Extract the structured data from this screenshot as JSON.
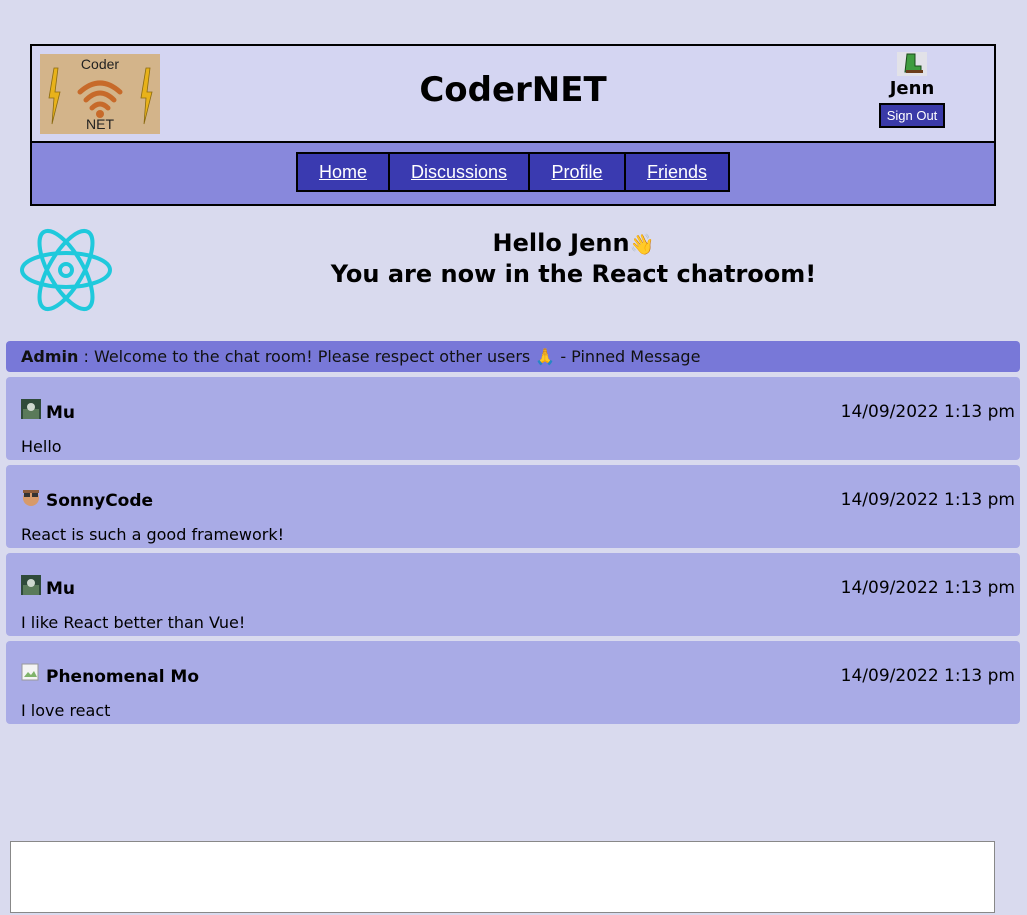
{
  "header": {
    "logo_top": "Coder",
    "logo_bottom": "NET",
    "title": "CoderNET",
    "user_name": "Jenn",
    "signout_label": "Sign Out"
  },
  "nav": {
    "items": [
      "Home",
      "Discussions",
      "Profile",
      "Friends"
    ]
  },
  "greeting": {
    "line1": "Hello Jenn",
    "wave": "👋",
    "line2": "You are now in the React chatroom!"
  },
  "pinned": {
    "author": "Admin",
    "separator": " : ",
    "text": "Welcome to the chat room! Please respect other users ",
    "emoji": "🙏",
    "suffix": " - Pinned Message"
  },
  "messages": [
    {
      "user": "Mu",
      "time": "14/09/2022 1:13 pm",
      "text": "Hello"
    },
    {
      "user": "SonnyCode",
      "time": "14/09/2022 1:13 pm",
      "text": "React is such a good framework!"
    },
    {
      "user": "Mu",
      "time": "14/09/2022 1:13 pm",
      "text": "I like React better than Vue!"
    },
    {
      "user": "Phenomenal Mo",
      "time": "14/09/2022 1:13 pm",
      "text": "I love react"
    }
  ],
  "chat_input": {
    "value": ""
  },
  "colors": {
    "page_bg": "#d9daee",
    "header_bg": "#d4d5f2",
    "nav_bg": "#8888dc",
    "nav_button": "#3a3ab0",
    "pinned_bg": "#7878d8",
    "message_bg": "#a9abe6",
    "react_cyan": "#1fc9dc"
  }
}
